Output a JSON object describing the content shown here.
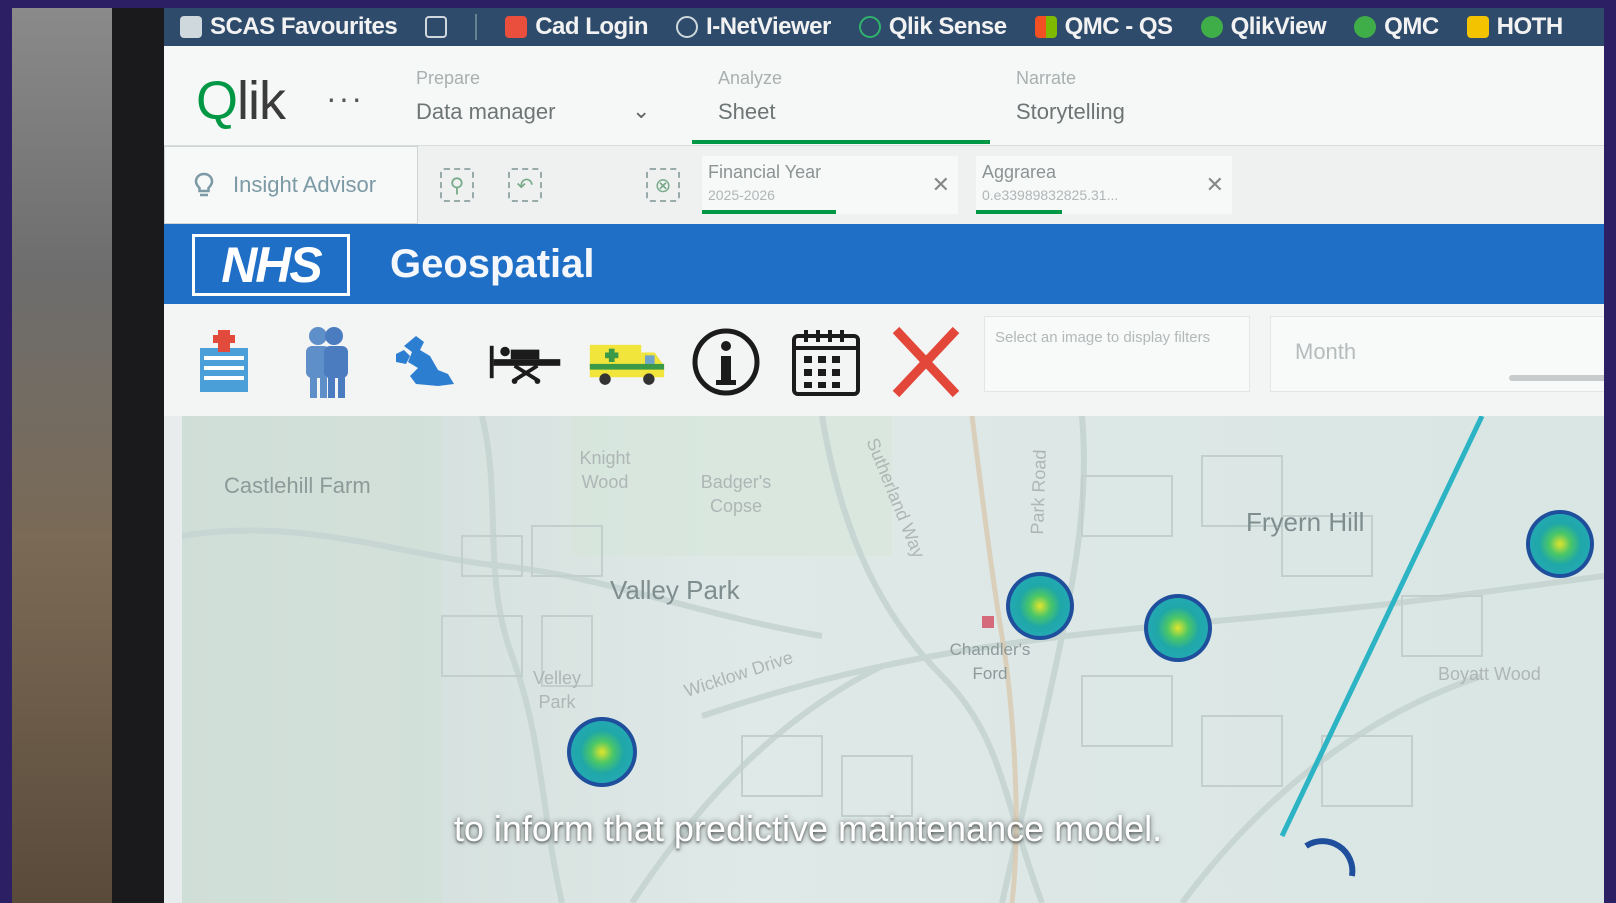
{
  "bookmarks": [
    {
      "label": "SCAS Favourites",
      "icon": "folder-icon",
      "color": "#cfd8dc"
    },
    {
      "label": "",
      "icon": "window-icon",
      "color": "#cfd8dc"
    },
    {
      "label": "Cad Login",
      "icon": "scas-icon",
      "color": "#e94f3c"
    },
    {
      "label": "I-NetViewer",
      "icon": "globe-icon",
      "color": "#cfd8dc"
    },
    {
      "label": "Qlik Sense",
      "icon": "qlik-sense-icon",
      "color": "#2fb36b"
    },
    {
      "label": "QMC - QS",
      "icon": "microsoft-icon",
      "color": "#f25022"
    },
    {
      "label": "QlikView",
      "icon": "qlikview-icon",
      "color": "#3fae49"
    },
    {
      "label": "QMC",
      "icon": "qmc-icon",
      "color": "#3fae49"
    },
    {
      "label": "HOTH",
      "icon": "hoth-icon",
      "color": "#f3c300"
    }
  ],
  "qlik": {
    "logo": "Qlik",
    "more": "···",
    "prepare": {
      "caption": "Prepare",
      "value": "Data manager"
    },
    "analyze": {
      "caption": "Analyze",
      "value": "Sheet"
    },
    "narrate": {
      "caption": "Narrate",
      "value": "Storytelling"
    }
  },
  "selections": {
    "insight_label": "Insight Advisor",
    "chips": [
      {
        "title": "Financial Year",
        "value": "2025-2026"
      },
      {
        "title": "Aggrarea",
        "value": "0.e33989832825.31..."
      }
    ]
  },
  "banner": {
    "logo": "NHS",
    "title": "Geospatial"
  },
  "toolbar": {
    "icons": [
      "hospital-icon",
      "people-icon",
      "uk-map-icon",
      "stretcher-icon",
      "ambulance-icon",
      "info-icon",
      "calendar-icon",
      "close-icon"
    ],
    "filter_hint": "Select an image to display filters",
    "month_label": "Month"
  },
  "map": {
    "places": [
      {
        "name": "Castlehill Farm"
      },
      {
        "name": "Knight Wood"
      },
      {
        "name": "Badger's Copse"
      },
      {
        "name": "Valley Park"
      },
      {
        "name": "Fryern Hill"
      },
      {
        "name": "Chandler's Ford"
      },
      {
        "name": "Boyatt Wood"
      },
      {
        "name": "Velley Park"
      },
      {
        "name": "Wicklow Drive"
      },
      {
        "name": "Park Road"
      },
      {
        "name": "Sutherland Way"
      }
    ],
    "hotspot_colors": [
      "#1e4fa0",
      "#1fa6a8",
      "#3bc46a",
      "#d9df2a"
    ]
  },
  "caption": "to inform that predictive maintenance model."
}
